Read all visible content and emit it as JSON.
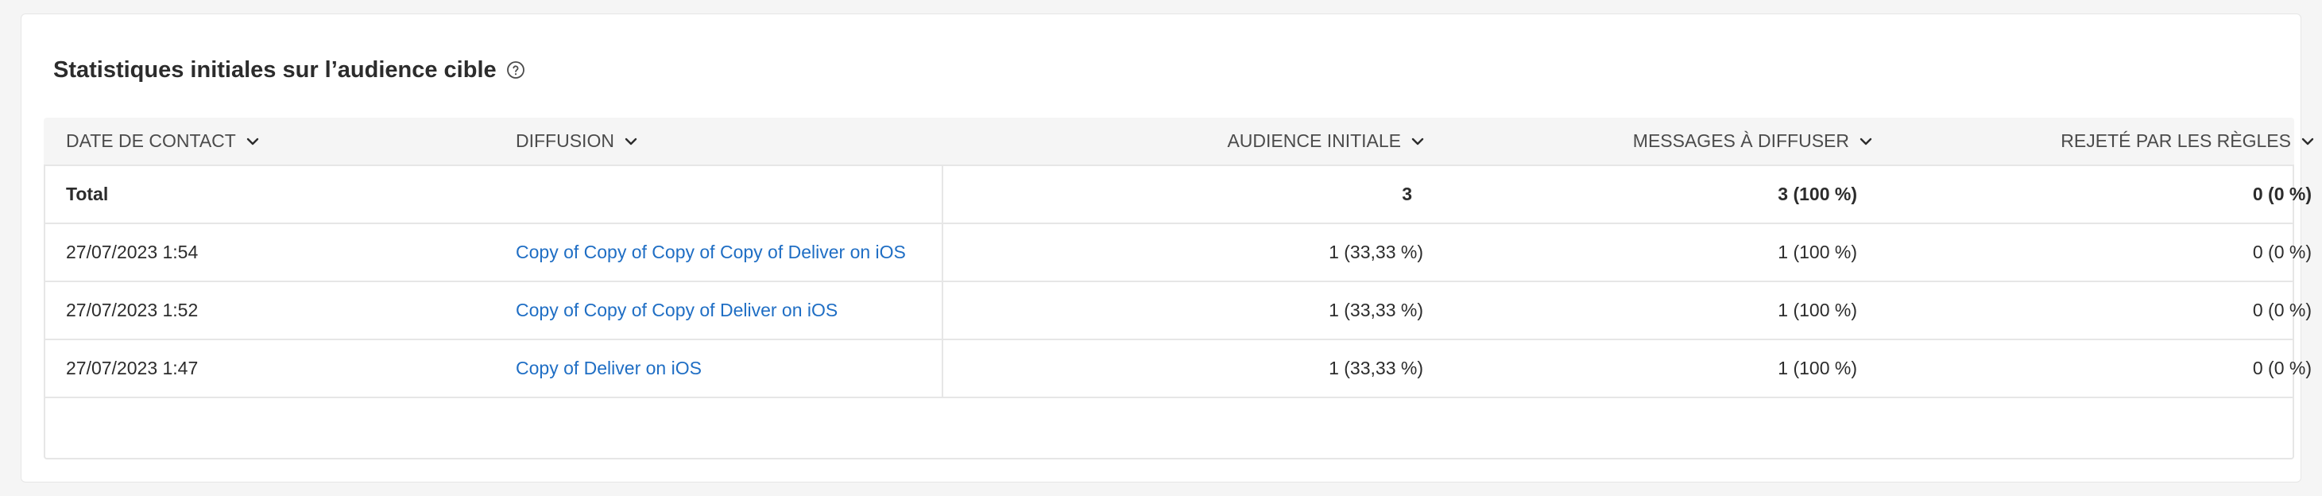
{
  "section": {
    "title": "Statistiques initiales sur l’audience cible",
    "help_icon": "help-circle-icon"
  },
  "table": {
    "columns": [
      {
        "label": "DATE DE CONTACT",
        "icon": "chevron-down-icon"
      },
      {
        "label": "DIFFUSION",
        "icon": "chevron-down-icon"
      },
      {
        "label": "AUDIENCE INITIALE",
        "icon": "chevron-down-icon"
      },
      {
        "label": "MESSAGES À DIFFUSER",
        "icon": "chevron-down-icon"
      },
      {
        "label": "REJETÉ PAR LES RÈGLES",
        "icon": "chevron-down-icon"
      }
    ],
    "total_row": {
      "label": "Total",
      "audience": "3",
      "messages": "3 (100 %)",
      "rejected": "0 (0 %)"
    },
    "rows": [
      {
        "date": "27/07/2023 1:54",
        "delivery": "Copy of Copy of Copy of Copy of Deliver on iOS",
        "audience": "1 (33,33 %)",
        "messages": "1 (100 %)",
        "rejected": "0 (0 %)"
      },
      {
        "date": "27/07/2023 1:52",
        "delivery": "Copy of Copy of Copy of Deliver on iOS",
        "audience": "1 (33,33 %)",
        "messages": "1 (100 %)",
        "rejected": "0 (0 %)"
      },
      {
        "date": "27/07/2023 1:47",
        "delivery": "Copy of Deliver on iOS",
        "audience": "1 (33,33 %)",
        "messages": "1 (100 %)",
        "rejected": "0 (0 %)"
      }
    ]
  },
  "colors": {
    "link": "#1f6ec4",
    "header_bg": "#f5f5f5",
    "border": "#e6e6e6",
    "text": "#2c2c2c"
  }
}
